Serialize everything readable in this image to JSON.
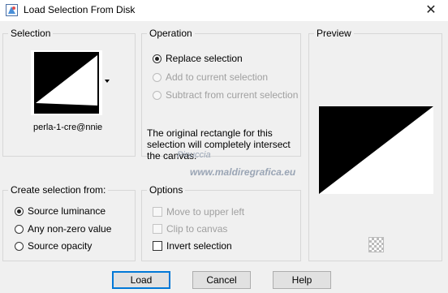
{
  "window": {
    "title": "Load Selection From Disk",
    "close_glyph": "✕"
  },
  "selection": {
    "label": "Selection",
    "thumbnail_name": "perla-1-cre@nnie"
  },
  "operation": {
    "label": "Operation",
    "options": [
      {
        "label": "Replace selection",
        "checked": true,
        "enabled": true
      },
      {
        "label": "Add to current selection",
        "checked": false,
        "enabled": false
      },
      {
        "label": "Subtract from current selection",
        "checked": false,
        "enabled": false
      }
    ],
    "info_text": "The original rectangle for this selection will completely intersect the canvas."
  },
  "preview": {
    "label": "Preview",
    "background_button_icon": "checkerboard-icon"
  },
  "create_from": {
    "label": "Create selection from:",
    "options": [
      {
        "label": "Source luminance",
        "checked": true
      },
      {
        "label": "Any non-zero value",
        "checked": false
      },
      {
        "label": "Source opacity",
        "checked": false
      }
    ]
  },
  "options": {
    "label": "Options",
    "items": [
      {
        "label": "Move to upper left",
        "checked": false,
        "enabled": false
      },
      {
        "label": "Clip to canvas",
        "checked": false,
        "enabled": false
      },
      {
        "label": "Invert selection",
        "checked": false,
        "enabled": true
      }
    ]
  },
  "watermark": {
    "line1": "Pinuccia",
    "line2": "www.maldiregrafica.eu"
  },
  "buttons": {
    "load": "Load",
    "cancel": "Cancel",
    "help": "Help"
  },
  "colors": {
    "accent": "#0078d7",
    "dialog_bg": "#f0f0f0"
  }
}
